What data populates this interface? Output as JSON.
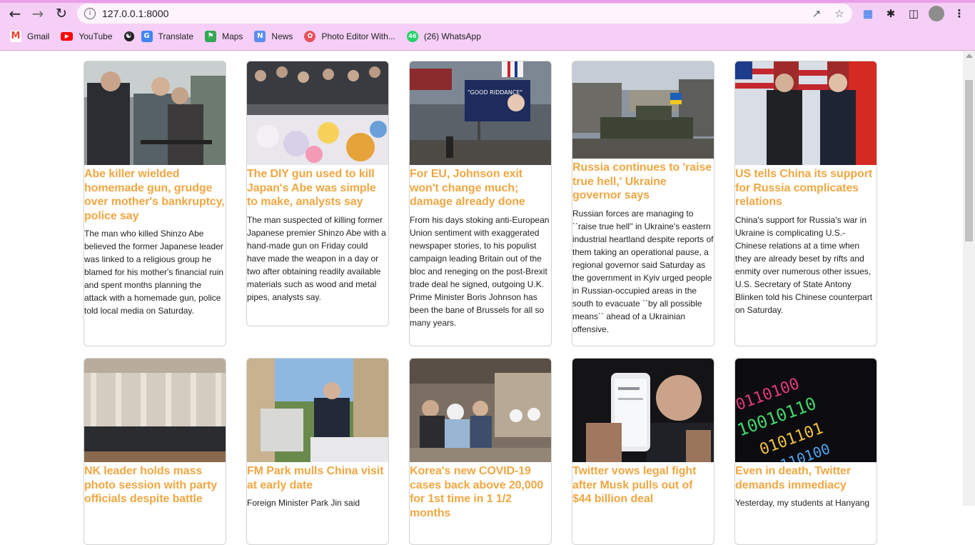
{
  "browser": {
    "url": "127.0.0.1:8000",
    "bookmarks": [
      {
        "label": "Gmail",
        "icon": "gmail-icon"
      },
      {
        "label": "YouTube",
        "icon": "youtube-icon"
      },
      {
        "label": "",
        "icon": "globe-icon"
      },
      {
        "label": "Translate",
        "icon": "translate-icon"
      },
      {
        "label": "Maps",
        "icon": "maps-icon"
      },
      {
        "label": "News",
        "icon": "news-icon"
      },
      {
        "label": "Photo Editor With...",
        "icon": "photo-editor-icon"
      },
      {
        "label": "(26) WhatsApp",
        "icon": "whatsapp-icon"
      }
    ]
  },
  "articles": [
    {
      "title": "Abe killer wielded homemade gun, grudge over mother's bankruptcy, police say",
      "summary": "The man who killed Shinzo Abe believed the former Japanese leader was linked to a religious group he blamed for his mother's financial ruin and spent months planning the attack with a homemade gun, police told local media on Saturday.",
      "image": "photo-police-arrest"
    },
    {
      "title": "The DIY gun used to kill Japan's Abe was simple to make, analysts say",
      "summary": "The man suspected of killing former Japanese premier Shinzo Abe with a hand-made gun on Friday could have made the weapon in a day or two after obtaining readily available materials such as wood and metal pipes, analysts say.",
      "image": "photo-mourners-flowers"
    },
    {
      "title": "For EU, Johnson exit won't change much; damage already done",
      "summary": "From his days stoking anti-European Union sentiment with exaggerated newspaper stories, to his populist campaign leading Britain out of the bloc and reneging on the post-Brexit trade deal he signed, outgoing U.K. Prime Minister Boris Johnson has been the bane of Brussels for all so many years.",
      "image": "photo-good-riddance-billboard",
      "billboard_text": "\"GOOD RIDDANCE\""
    },
    {
      "title": "Russia continues to 'raise true hell,' Ukraine governor says",
      "summary": "Russian forces are managing to ``raise true hell'' in Ukraine's eastern industrial heartland despite reports of them taking an operational pause, a regional governor said Saturday as the government in Kyiv urged people in Russian-occupied areas in the south to evacuate ``by all possible means`` ahead of a Ukrainian offensive.",
      "image": "photo-tank-street"
    },
    {
      "title": "US tells China its support for Russia complicates relations",
      "summary": "China's support for Russia's war in Ukraine is complicating U.S.-Chinese relations at a time when they are already beset by rifts and enmity over numerous other issues, U.S. Secretary of State Antony Blinken told his Chinese counterpart on Saturday.",
      "image": "photo-diplomats-handshake"
    },
    {
      "title": "NK leader holds mass photo session with party officials despite battle",
      "summary": "",
      "image": "photo-hall-group"
    },
    {
      "title": "FM Park mulls China visit at early date",
      "summary": "Foreign Minister Park Jin said",
      "image": "photo-minister-golfcart"
    },
    {
      "title": "Korea's new COVID-19 cases back above 20,000 for 1st time in 1 1/2 months",
      "summary": "",
      "image": "photo-testing-queue"
    },
    {
      "title": "Twitter vows legal fight after Musk pulls out of $44 billion deal",
      "summary": "",
      "image": "photo-musk-phone"
    },
    {
      "title": "Even in death, Twitter demands immediacy",
      "summary": "Yesterday, my students at Hanyang",
      "image": "photo-binary-code"
    }
  ],
  "colors": {
    "accent": "#f0a742",
    "chrome": "#f5cff6"
  }
}
